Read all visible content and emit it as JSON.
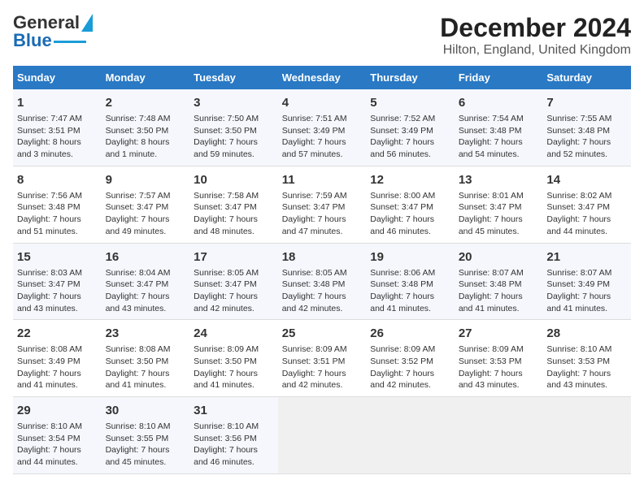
{
  "header": {
    "logo_general": "General",
    "logo_blue": "Blue",
    "title": "December 2024",
    "subtitle": "Hilton, England, United Kingdom"
  },
  "columns": [
    "Sunday",
    "Monday",
    "Tuesday",
    "Wednesday",
    "Thursday",
    "Friday",
    "Saturday"
  ],
  "weeks": [
    [
      {
        "day": "1",
        "sunrise": "Sunrise: 7:47 AM",
        "sunset": "Sunset: 3:51 PM",
        "daylight": "Daylight: 8 hours and 3 minutes."
      },
      {
        "day": "2",
        "sunrise": "Sunrise: 7:48 AM",
        "sunset": "Sunset: 3:50 PM",
        "daylight": "Daylight: 8 hours and 1 minute."
      },
      {
        "day": "3",
        "sunrise": "Sunrise: 7:50 AM",
        "sunset": "Sunset: 3:50 PM",
        "daylight": "Daylight: 7 hours and 59 minutes."
      },
      {
        "day": "4",
        "sunrise": "Sunrise: 7:51 AM",
        "sunset": "Sunset: 3:49 PM",
        "daylight": "Daylight: 7 hours and 57 minutes."
      },
      {
        "day": "5",
        "sunrise": "Sunrise: 7:52 AM",
        "sunset": "Sunset: 3:49 PM",
        "daylight": "Daylight: 7 hours and 56 minutes."
      },
      {
        "day": "6",
        "sunrise": "Sunrise: 7:54 AM",
        "sunset": "Sunset: 3:48 PM",
        "daylight": "Daylight: 7 hours and 54 minutes."
      },
      {
        "day": "7",
        "sunrise": "Sunrise: 7:55 AM",
        "sunset": "Sunset: 3:48 PM",
        "daylight": "Daylight: 7 hours and 52 minutes."
      }
    ],
    [
      {
        "day": "8",
        "sunrise": "Sunrise: 7:56 AM",
        "sunset": "Sunset: 3:48 PM",
        "daylight": "Daylight: 7 hours and 51 minutes."
      },
      {
        "day": "9",
        "sunrise": "Sunrise: 7:57 AM",
        "sunset": "Sunset: 3:47 PM",
        "daylight": "Daylight: 7 hours and 49 minutes."
      },
      {
        "day": "10",
        "sunrise": "Sunrise: 7:58 AM",
        "sunset": "Sunset: 3:47 PM",
        "daylight": "Daylight: 7 hours and 48 minutes."
      },
      {
        "day": "11",
        "sunrise": "Sunrise: 7:59 AM",
        "sunset": "Sunset: 3:47 PM",
        "daylight": "Daylight: 7 hours and 47 minutes."
      },
      {
        "day": "12",
        "sunrise": "Sunrise: 8:00 AM",
        "sunset": "Sunset: 3:47 PM",
        "daylight": "Daylight: 7 hours and 46 minutes."
      },
      {
        "day": "13",
        "sunrise": "Sunrise: 8:01 AM",
        "sunset": "Sunset: 3:47 PM",
        "daylight": "Daylight: 7 hours and 45 minutes."
      },
      {
        "day": "14",
        "sunrise": "Sunrise: 8:02 AM",
        "sunset": "Sunset: 3:47 PM",
        "daylight": "Daylight: 7 hours and 44 minutes."
      }
    ],
    [
      {
        "day": "15",
        "sunrise": "Sunrise: 8:03 AM",
        "sunset": "Sunset: 3:47 PM",
        "daylight": "Daylight: 7 hours and 43 minutes."
      },
      {
        "day": "16",
        "sunrise": "Sunrise: 8:04 AM",
        "sunset": "Sunset: 3:47 PM",
        "daylight": "Daylight: 7 hours and 43 minutes."
      },
      {
        "day": "17",
        "sunrise": "Sunrise: 8:05 AM",
        "sunset": "Sunset: 3:47 PM",
        "daylight": "Daylight: 7 hours and 42 minutes."
      },
      {
        "day": "18",
        "sunrise": "Sunrise: 8:05 AM",
        "sunset": "Sunset: 3:48 PM",
        "daylight": "Daylight: 7 hours and 42 minutes."
      },
      {
        "day": "19",
        "sunrise": "Sunrise: 8:06 AM",
        "sunset": "Sunset: 3:48 PM",
        "daylight": "Daylight: 7 hours and 41 minutes."
      },
      {
        "day": "20",
        "sunrise": "Sunrise: 8:07 AM",
        "sunset": "Sunset: 3:48 PM",
        "daylight": "Daylight: 7 hours and 41 minutes."
      },
      {
        "day": "21",
        "sunrise": "Sunrise: 8:07 AM",
        "sunset": "Sunset: 3:49 PM",
        "daylight": "Daylight: 7 hours and 41 minutes."
      }
    ],
    [
      {
        "day": "22",
        "sunrise": "Sunrise: 8:08 AM",
        "sunset": "Sunset: 3:49 PM",
        "daylight": "Daylight: 7 hours and 41 minutes."
      },
      {
        "day": "23",
        "sunrise": "Sunrise: 8:08 AM",
        "sunset": "Sunset: 3:50 PM",
        "daylight": "Daylight: 7 hours and 41 minutes."
      },
      {
        "day": "24",
        "sunrise": "Sunrise: 8:09 AM",
        "sunset": "Sunset: 3:50 PM",
        "daylight": "Daylight: 7 hours and 41 minutes."
      },
      {
        "day": "25",
        "sunrise": "Sunrise: 8:09 AM",
        "sunset": "Sunset: 3:51 PM",
        "daylight": "Daylight: 7 hours and 42 minutes."
      },
      {
        "day": "26",
        "sunrise": "Sunrise: 8:09 AM",
        "sunset": "Sunset: 3:52 PM",
        "daylight": "Daylight: 7 hours and 42 minutes."
      },
      {
        "day": "27",
        "sunrise": "Sunrise: 8:09 AM",
        "sunset": "Sunset: 3:53 PM",
        "daylight": "Daylight: 7 hours and 43 minutes."
      },
      {
        "day": "28",
        "sunrise": "Sunrise: 8:10 AM",
        "sunset": "Sunset: 3:53 PM",
        "daylight": "Daylight: 7 hours and 43 minutes."
      }
    ],
    [
      {
        "day": "29",
        "sunrise": "Sunrise: 8:10 AM",
        "sunset": "Sunset: 3:54 PM",
        "daylight": "Daylight: 7 hours and 44 minutes."
      },
      {
        "day": "30",
        "sunrise": "Sunrise: 8:10 AM",
        "sunset": "Sunset: 3:55 PM",
        "daylight": "Daylight: 7 hours and 45 minutes."
      },
      {
        "day": "31",
        "sunrise": "Sunrise: 8:10 AM",
        "sunset": "Sunset: 3:56 PM",
        "daylight": "Daylight: 7 hours and 46 minutes."
      },
      null,
      null,
      null,
      null
    ]
  ]
}
